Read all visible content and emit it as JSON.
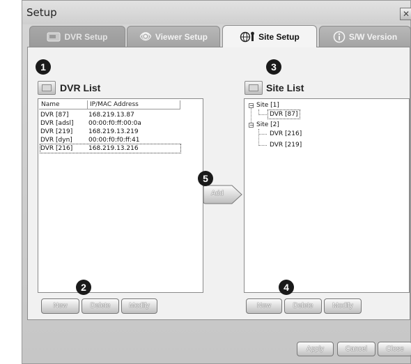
{
  "window": {
    "title": "Setup",
    "close_glyph": "✕"
  },
  "tabs": [
    {
      "label": "DVR Setup",
      "icon": "dvr-icon"
    },
    {
      "label": "Viewer Setup",
      "icon": "eye-wrench-icon"
    },
    {
      "label": "Site Setup",
      "icon": "globe-wrench-icon"
    },
    {
      "label": "S/W Version",
      "icon": "info-icon"
    }
  ],
  "callouts": [
    "1",
    "2",
    "3",
    "4",
    "5"
  ],
  "dvr_list": {
    "title": "DVR List",
    "columns": [
      "Name",
      "IP/MAC Address"
    ],
    "rows": [
      {
        "name": "DVR [87]",
        "address": "168.219.13.87"
      },
      {
        "name": "DVR [adsl]",
        "address": "00:00:f0:ff:00:0a"
      },
      {
        "name": "DVR [219]",
        "address": "168.219.13.219"
      },
      {
        "name": "DVR [dyn]",
        "address": "00:00:f0:f0:ff:41"
      },
      {
        "name": "DVR [216]",
        "address": "168.219.13.216"
      }
    ],
    "buttons": {
      "new": "New",
      "delete": "Delete",
      "modify": "Modify"
    }
  },
  "site_list": {
    "title": "Site List",
    "tree": [
      {
        "label": "Site [1]",
        "children": [
          "DVR [87]"
        ]
      },
      {
        "label": "Site [2]",
        "children": [
          "DVR [216]",
          "DVR [219]"
        ]
      }
    ],
    "buttons": {
      "new": "New",
      "delete": "Delete",
      "modify": "Modify"
    }
  },
  "add_button": "Add",
  "footer": {
    "apply": "Apply",
    "cancel": "Cancel",
    "close": "Close"
  }
}
